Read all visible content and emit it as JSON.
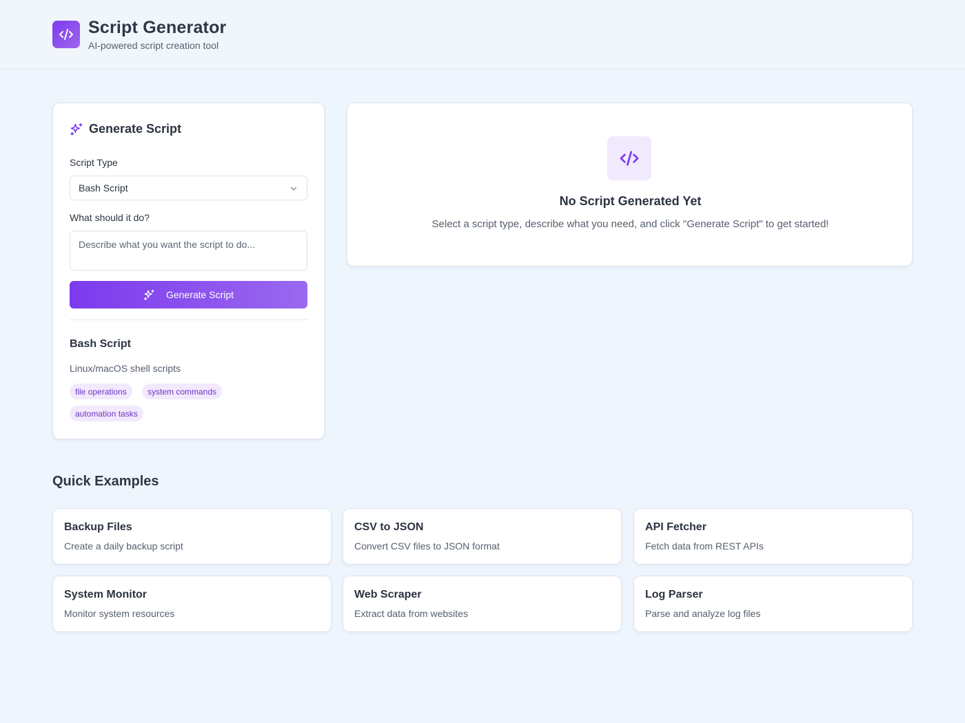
{
  "header": {
    "title": "Script Generator",
    "subtitle": "AI-powered script creation tool",
    "logo_icon": "code-icon"
  },
  "generator": {
    "title": "Generate Script",
    "title_icon": "sparkles-icon",
    "script_type_label": "Script Type",
    "script_type_value": "Bash Script",
    "prompt_label": "What should it do?",
    "prompt_placeholder": "Describe what you want the script to do...",
    "prompt_value": "",
    "button_label": "Generate Script",
    "button_icon": "sparkles-icon"
  },
  "script_info": {
    "name": "Bash Script",
    "description": "Linux/macOS shell scripts",
    "tags": [
      "file operations",
      "system commands",
      "automation tasks"
    ]
  },
  "output": {
    "icon": "code-icon",
    "title": "No Script Generated Yet",
    "description": "Select a script type, describe what you need, and click \"Generate Script\" to get started!"
  },
  "quick_examples": {
    "title": "Quick Examples",
    "items": [
      {
        "name": "Backup Files",
        "description": "Create a daily backup script"
      },
      {
        "name": "CSV to JSON",
        "description": "Convert CSV files to JSON format"
      },
      {
        "name": "API Fetcher",
        "description": "Fetch data from REST APIs"
      },
      {
        "name": "System Monitor",
        "description": "Monitor system resources"
      },
      {
        "name": "Web Scraper",
        "description": "Extract data from websites"
      },
      {
        "name": "Log Parser",
        "description": "Parse and analyze log files"
      }
    ]
  },
  "colors": {
    "accent": "#7c3aed",
    "accent_light": "#f2e9fd",
    "background": "#eef5fd"
  }
}
